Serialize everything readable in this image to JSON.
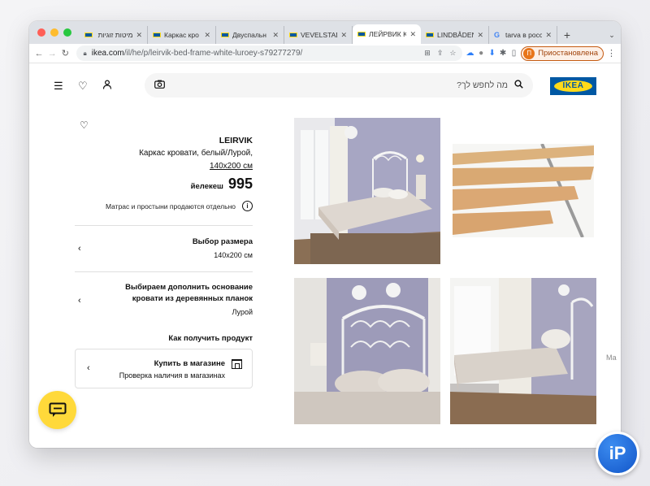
{
  "browser": {
    "tabs": [
      {
        "title": "מיטות זוגיות",
        "favicon": "ikea-favicon",
        "active": false
      },
      {
        "title": "Каркас кро",
        "favicon": "ikea-favicon",
        "active": false
      },
      {
        "title": "Двуспальн",
        "favicon": "ikea-favicon",
        "active": false
      },
      {
        "title": "VEVELSTAD",
        "favicon": "ikea-favicon",
        "active": false
      },
      {
        "title": "ЛЕЙРВИК K",
        "favicon": "ikea-favicon",
        "active": true
      },
      {
        "title": "LINDBÅDEN",
        "favicon": "ikea-favicon",
        "active": false
      },
      {
        "title": "tarva в росс",
        "favicon": "google-favicon",
        "active": false
      }
    ],
    "url_domain": "ikea.com",
    "url_path": "/il/he/p/leirvik-bed-frame-white-luroey-s79277279/",
    "profile_initial": "П",
    "profile_label": "Приостановлена",
    "google_letter": "G"
  },
  "header": {
    "search_placeholder": "מה לחפש לך?",
    "logo_text": "IKEA"
  },
  "product": {
    "name": "LEIRVIK",
    "description": "Каркас кровати, белый/Лурой,",
    "size": "140x200 см",
    "price": "995",
    "currency": "йелекеш",
    "note": "Матрас и простыни продаются отдельно",
    "note_icon": "i"
  },
  "options": [
    {
      "title": "Выбор размера",
      "value": "140x200 см"
    },
    {
      "title": "Выбираем дополнить основание кровати из деревянных планок",
      "value": "Лурой"
    }
  ],
  "delivery": {
    "heading": "Как получить продукт",
    "store_title": "Купить в магазине",
    "store_sub": "Проверка наличия в магазинах"
  },
  "side_hint": "Ма",
  "badge_text": "iP",
  "colors": {
    "ikea_blue": "#0058a3",
    "ikea_yellow": "#ffda1a",
    "chat_yellow": "#ffd93a",
    "profile_orange": "#e8751a"
  }
}
